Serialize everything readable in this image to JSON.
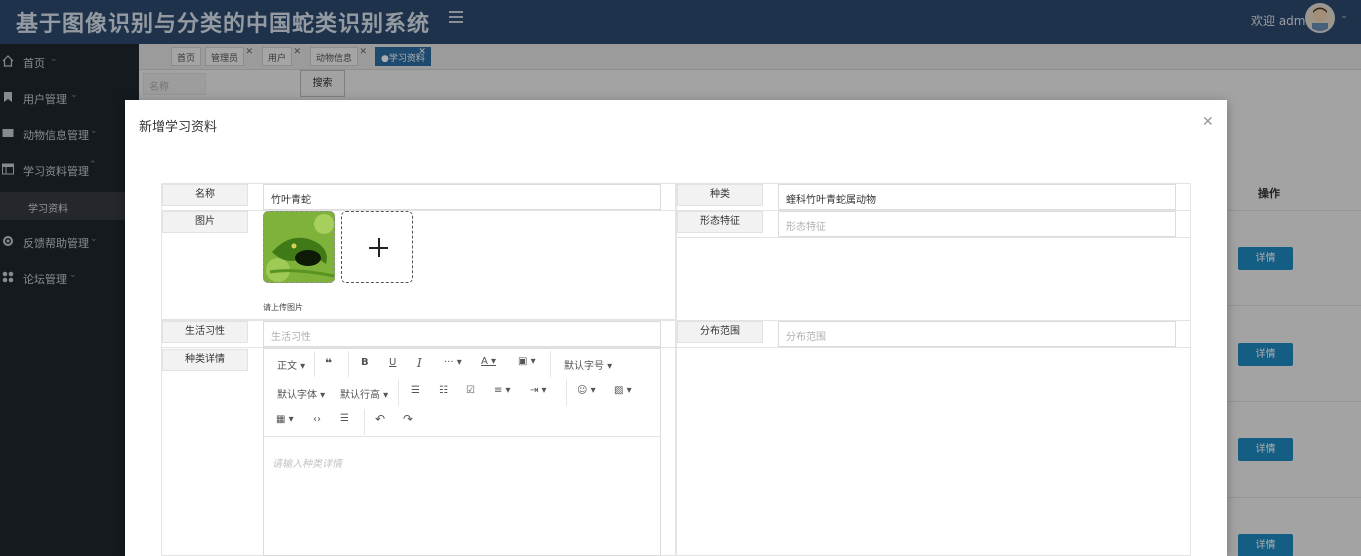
{
  "header": {
    "title": "基于图像识别与分类的中国蛇类识别系统",
    "welcome": "欢迎 admin"
  },
  "sidebar": {
    "items": [
      {
        "label": "首页",
        "icon": "home-icon"
      },
      {
        "label": "用户管理",
        "icon": "bookmark-icon"
      },
      {
        "label": "动物信息管理",
        "icon": "card-icon"
      },
      {
        "label": "学习资料管理",
        "icon": "list-icon"
      },
      {
        "label": "反馈帮助管理",
        "icon": "gear-icon"
      },
      {
        "label": "论坛管理",
        "icon": "grid-icon"
      }
    ],
    "sub_item": "学习资料"
  },
  "tabs": [
    "首页",
    "管理员",
    "用户",
    "动物信息",
    "学习资料"
  ],
  "search": {
    "placeholder": "名称",
    "button": "搜索"
  },
  "table": {
    "op_header": "操作",
    "detail_label": "详情"
  },
  "modal": {
    "title": "新增学习资料",
    "fields": {
      "name_label": "名称",
      "name_value": "竹叶青蛇",
      "species_label": "种类",
      "species_value": "蝰科竹叶青蛇属动物",
      "image_label": "图片",
      "image_hint": "请上传图片",
      "morph_label": "形态特征",
      "morph_placeholder": "形态特征",
      "habit_label": "生活习性",
      "habit_placeholder": "生活习性",
      "range_label": "分布范围",
      "range_placeholder": "分布范围",
      "detail_label": "种类详情"
    },
    "editor": {
      "paragraph": "正文",
      "more": "···",
      "font_size": "默认字号",
      "font_family": "默认字体",
      "line_height": "默认行高",
      "placeholder": "请输入种类详情"
    }
  },
  "colors": {
    "header_bg": "#2f4b6f",
    "sidebar_bg": "#20272d",
    "active_tab": "#2e6da4",
    "detail_button": "#1e8bc3"
  }
}
